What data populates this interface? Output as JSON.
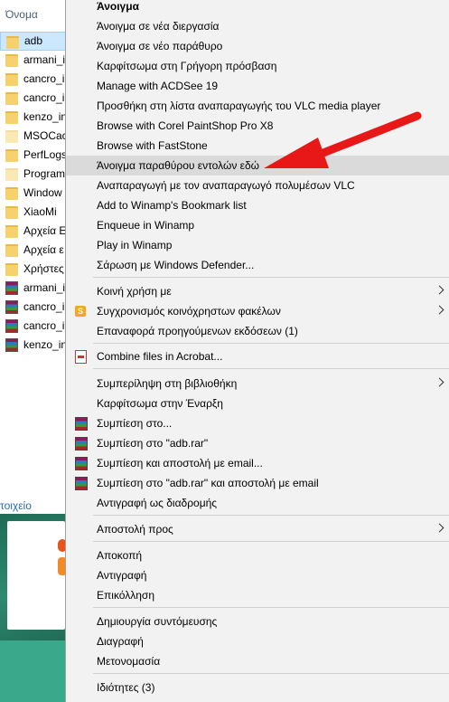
{
  "explorer": {
    "column_header": "Όνομα",
    "status_text": "τοιχείο",
    "files": [
      {
        "name": "adb",
        "type": "folder",
        "selected": true
      },
      {
        "name": "armani_i",
        "type": "folder"
      },
      {
        "name": "cancro_i",
        "type": "folder"
      },
      {
        "name": "cancro_i",
        "type": "folder"
      },
      {
        "name": "kenzo_in",
        "type": "folder"
      },
      {
        "name": "MSOCac",
        "type": "folder-light"
      },
      {
        "name": "PerfLogs",
        "type": "folder"
      },
      {
        "name": "Program",
        "type": "folder-light"
      },
      {
        "name": "Window",
        "type": "folder"
      },
      {
        "name": "XiaoMi",
        "type": "folder"
      },
      {
        "name": "Αρχεία Ε",
        "type": "folder"
      },
      {
        "name": "Αρχεία ε",
        "type": "folder"
      },
      {
        "name": "Χρήστες",
        "type": "folder"
      },
      {
        "name": "armani_i",
        "type": "rar"
      },
      {
        "name": "cancro_i",
        "type": "rar"
      },
      {
        "name": "cancro_i",
        "type": "rar"
      },
      {
        "name": "kenzo_in",
        "type": "rar"
      }
    ]
  },
  "menu": {
    "items": [
      {
        "label": "Άνοιγμα",
        "bold": true
      },
      {
        "label": "Άνοιγμα σε νέα διεργασία"
      },
      {
        "label": "Άνοιγμα σε νέο παράθυρο"
      },
      {
        "label": "Καρφίτσωμα στη Γρήγορη πρόσβαση"
      },
      {
        "label": "Manage with ACDSee 19"
      },
      {
        "label": "Προσθήκη στη λίστα αναπαραγωγής του VLC media player"
      },
      {
        "label": "Browse with Corel PaintShop Pro X8"
      },
      {
        "label": "Browse with FastStone"
      },
      {
        "label": "Άνοιγμα παραθύρου εντολών εδώ",
        "highlighted": true
      },
      {
        "label": "Αναπαραγωγή με τον αναπαραγωγό πολυμέσων VLC"
      },
      {
        "label": "Add to Winamp's Bookmark list"
      },
      {
        "label": "Enqueue in Winamp"
      },
      {
        "label": "Play in Winamp"
      },
      {
        "label": "Σάρωση με Windows Defender..."
      },
      {
        "label": "Κοινή χρήση με",
        "submenu": true
      },
      {
        "label": "Συγχρονισμός κοινόχρηστων φακέλων",
        "submenu": true,
        "icon": "sync-icon"
      },
      {
        "label": "Επαναφορά προηγούμενων εκδόσεων (1)"
      },
      {
        "label": "Combine files in Acrobat...",
        "icon": "acrobat-icon"
      },
      {
        "label": "Συμπερίληψη στη βιβλιοθήκη",
        "submenu": true
      },
      {
        "label": "Καρφίτσωμα στην Έναρξη"
      },
      {
        "label": "Συμπίεση στο...",
        "icon": "winrar-icon"
      },
      {
        "label": "Συμπίεση στο \"adb.rar\"",
        "icon": "winrar-icon"
      },
      {
        "label": "Συμπίεση και αποστολή με email...",
        "icon": "winrar-icon"
      },
      {
        "label": "Συμπίεση στο \"adb.rar\" και αποστολή με email",
        "icon": "winrar-icon"
      },
      {
        "label": "Αντιγραφή ως διαδρομής"
      },
      {
        "label": "Αποστολή προς",
        "submenu": true
      },
      {
        "label": "Αποκοπή"
      },
      {
        "label": "Αντιγραφή"
      },
      {
        "label": "Επικόλληση"
      },
      {
        "label": "Δημιουργία συντόμευσης"
      },
      {
        "label": "Διαγραφή"
      },
      {
        "label": "Μετονομασία"
      },
      {
        "label": "Ιδιότητες (3)"
      }
    ]
  },
  "colors": {
    "menu_background": "#f2f2f2",
    "highlight": "#dadada",
    "selection": "#cce8ff",
    "arrow": "#e81818"
  }
}
